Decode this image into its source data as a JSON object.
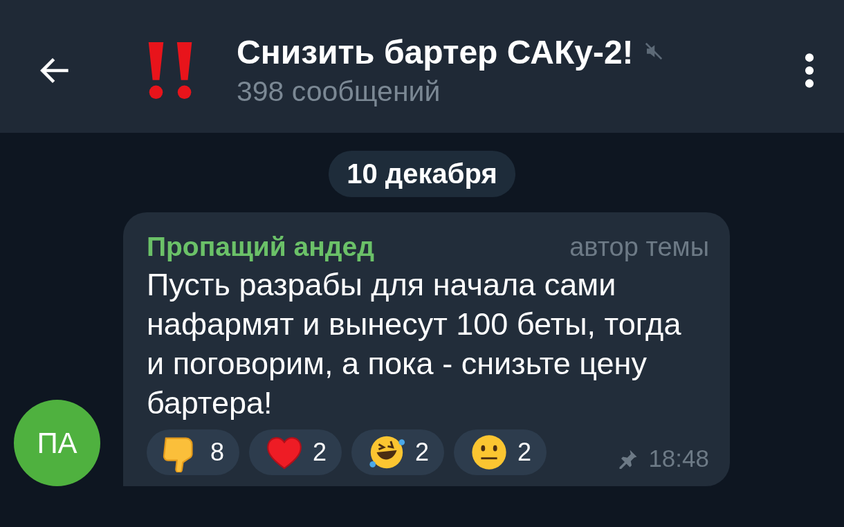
{
  "header": {
    "title": "Снизить бартер САКу-2!",
    "muted": true,
    "subtitle": "398 сообщений"
  },
  "date_badge": "10 декабря",
  "message": {
    "avatar_initials": "ПА",
    "author": "Пропащий андед",
    "role": "автор темы",
    "text": "Пусть разрабы для начала сами нафармят и вынесут 100 беты, тогда и поговорим, а пока - снизьте цену бартера!",
    "reactions": [
      {
        "kind": "thumbs-down",
        "count": "8"
      },
      {
        "kind": "heart",
        "count": "2"
      },
      {
        "kind": "rofl",
        "count": "2"
      },
      {
        "kind": "neutral",
        "count": "2"
      }
    ],
    "pinned": true,
    "time": "18:48"
  }
}
